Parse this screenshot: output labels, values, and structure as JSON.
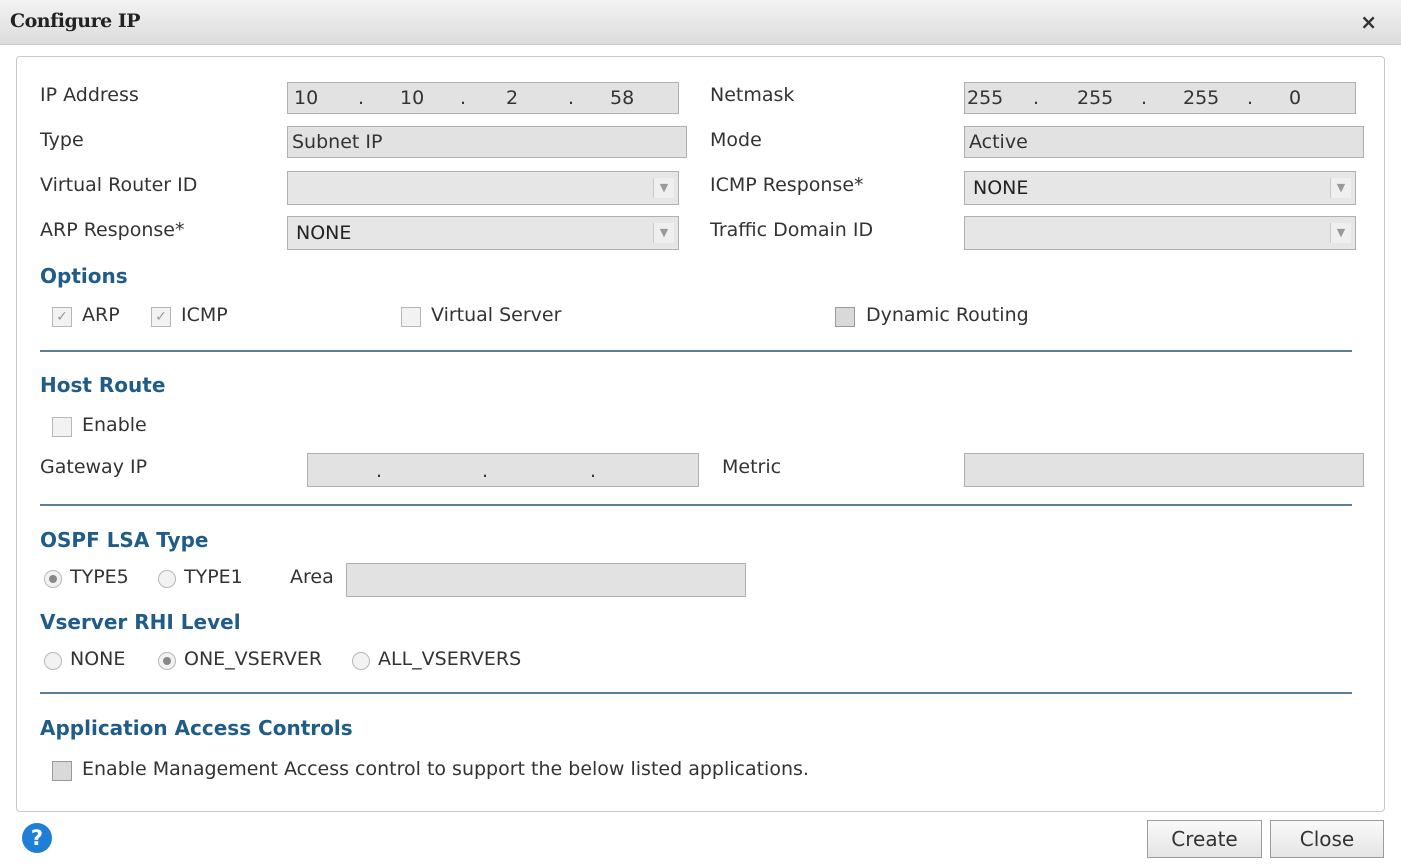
{
  "dialog": {
    "title": "Configure IP",
    "close_glyph": "×"
  },
  "form": {
    "ip_address_label": "IP Address",
    "ip_address": [
      "10",
      "10",
      "2",
      "58"
    ],
    "netmask_label": "Netmask",
    "netmask": [
      "255",
      "255",
      "255",
      "0"
    ],
    "type_label": "Type",
    "type_value": "Subnet IP",
    "mode_label": "Mode",
    "mode_value": "Active",
    "vrid_label": "Virtual Router ID",
    "vrid_value": "",
    "icmp_response_label": "ICMP Response*",
    "icmp_response_value": "NONE",
    "arp_response_label": "ARP Response*",
    "arp_response_value": "NONE",
    "traffic_domain_label": "Traffic Domain ID",
    "traffic_domain_value": ""
  },
  "options": {
    "heading": "Options",
    "arp": {
      "label": "ARP",
      "checked": true
    },
    "icmp": {
      "label": "ICMP",
      "checked": true
    },
    "virtual_server": {
      "label": "Virtual Server",
      "checked": false
    },
    "dynamic_routing": {
      "label": "Dynamic Routing",
      "checked": false
    }
  },
  "host_route": {
    "heading": "Host Route",
    "enable_label": "Enable",
    "gateway_label": "Gateway IP",
    "gateway": [
      "",
      "",
      "",
      ""
    ],
    "metric_label": "Metric",
    "metric_value": ""
  },
  "ospf": {
    "heading": "OSPF LSA Type",
    "type5_label": "TYPE5",
    "type1_label": "TYPE1",
    "selected": "TYPE5",
    "area_label": "Area",
    "area_value": ""
  },
  "rhi": {
    "heading": "Vserver RHI Level",
    "none_label": "NONE",
    "one_label": "ONE_VSERVER",
    "all_label": "ALL_VSERVERS",
    "selected": "ONE_VSERVER"
  },
  "access": {
    "heading": "Application Access Controls",
    "enable_label": "Enable Management Access control to support the below listed applications."
  },
  "footer": {
    "help_glyph": "?",
    "create_label": "Create",
    "close_label": "Close"
  }
}
